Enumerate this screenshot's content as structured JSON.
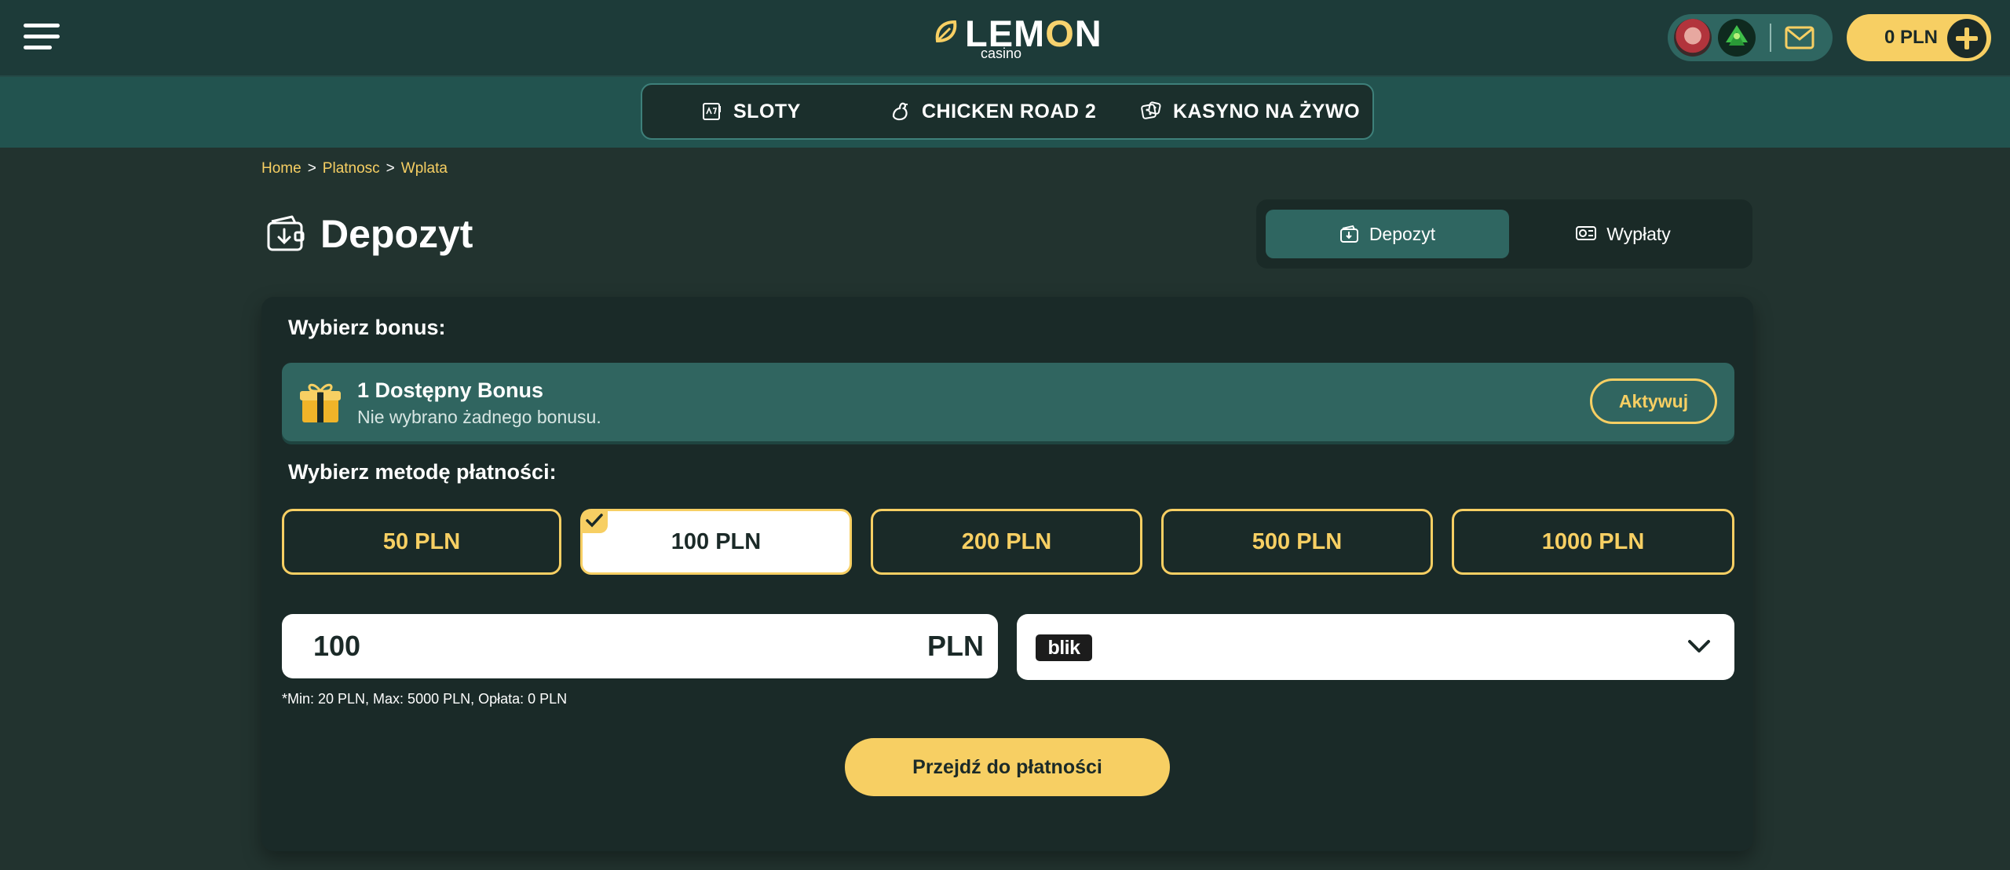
{
  "header": {
    "logo_word_start": "LEM",
    "logo_word_o": "O",
    "logo_word_end": "N",
    "logo_sub": "casino",
    "balance": "0 PLN"
  },
  "game_nav": {
    "items": [
      {
        "label": "SLOTY",
        "icon": "slot-machine-icon"
      },
      {
        "label": "CHICKEN ROAD 2",
        "icon": "chicken-icon"
      },
      {
        "label": "KASYNO NA ŻYWO",
        "icon": "dice-icon"
      }
    ]
  },
  "breadcrumb": [
    "Home",
    "Platnosc",
    "Wplata"
  ],
  "breadcrumb_separator": ">",
  "page_title": "Depozyt",
  "tabs": [
    {
      "label": "Depozyt",
      "active": true
    },
    {
      "label": "Wypłaty",
      "active": false
    }
  ],
  "bonus": {
    "section_label": "Wybierz bonus:",
    "title": "1 Dostępny Bonus",
    "subtitle": "Nie wybrano żadnego bonusu.",
    "action": "Aktywuj"
  },
  "payment": {
    "section_label": "Wybierz metodę płatności:",
    "amounts": [
      "50 PLN",
      "100 PLN",
      "200 PLN",
      "500 PLN",
      "1000 PLN"
    ],
    "selected_amount": "100 PLN",
    "input_value": "100",
    "currency": "PLN",
    "method": "blik",
    "limits": "*Min: 20 PLN, Max: 5000 PLN, Opłata: 0 PLN",
    "submit": "Przejdź do płatności"
  },
  "colors": {
    "accent": "#f7cf63",
    "background": "#22332f",
    "header": "#1d3b39",
    "teal": "#306560"
  }
}
